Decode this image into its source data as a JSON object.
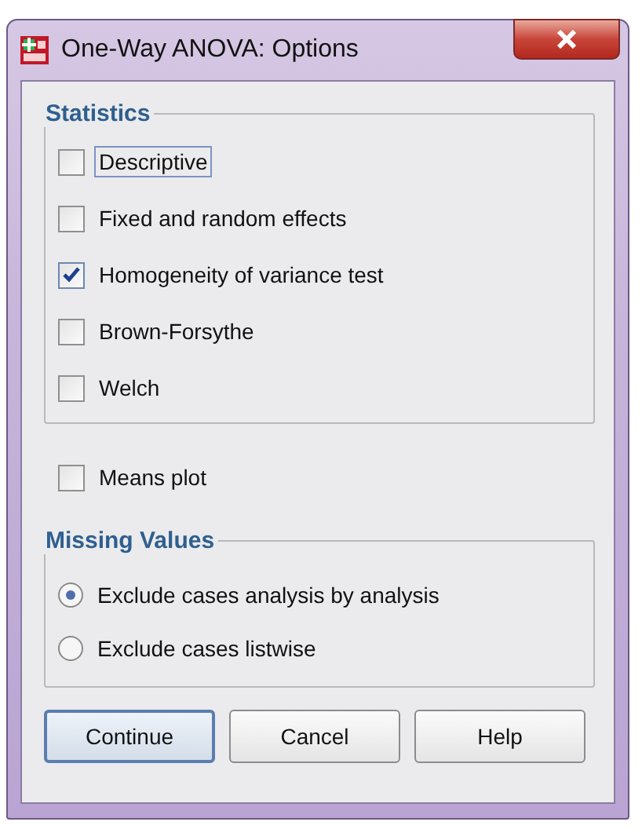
{
  "window": {
    "title": "One-Way ANOVA: Options"
  },
  "statistics": {
    "title": "Statistics",
    "options": [
      {
        "label": "Descriptive",
        "checked": false,
        "focused": true
      },
      {
        "label": "Fixed and random effects",
        "checked": false,
        "focused": false
      },
      {
        "label": "Homogeneity of variance test",
        "checked": true,
        "focused": false
      },
      {
        "label": "Brown-Forsythe",
        "checked": false,
        "focused": false
      },
      {
        "label": "Welch",
        "checked": false,
        "focused": false
      }
    ]
  },
  "means_plot": {
    "label": "Means plot",
    "checked": false
  },
  "missing_values": {
    "title": "Missing Values",
    "options": [
      {
        "label": "Exclude cases analysis by analysis",
        "selected": true
      },
      {
        "label": "Exclude cases listwise",
        "selected": false
      }
    ]
  },
  "buttons": [
    {
      "label": "Continue",
      "default": true
    },
    {
      "label": "Cancel",
      "default": false
    },
    {
      "label": "Help",
      "default": false
    }
  ]
}
